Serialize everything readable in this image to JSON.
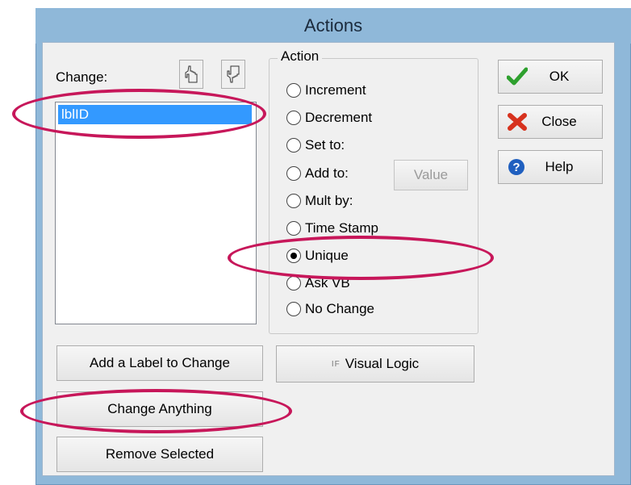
{
  "window": {
    "title": "Actions"
  },
  "change_panel": {
    "label": "Change:",
    "items": [
      "lblID"
    ],
    "selected_index": 0
  },
  "action_group": {
    "legend": "Action",
    "options": [
      {
        "label": "Increment",
        "checked": false
      },
      {
        "label": "Decrement",
        "checked": false
      },
      {
        "label": "Set to:",
        "checked": false
      },
      {
        "label": "Add to:",
        "checked": false
      },
      {
        "label": "Mult by:",
        "checked": false
      },
      {
        "label": "Time Stamp",
        "checked": false
      },
      {
        "label": "Unique",
        "checked": true
      },
      {
        "label": "Ask VB",
        "checked": false
      },
      {
        "label": "No Change",
        "checked": false
      }
    ],
    "value_button": "Value"
  },
  "buttons": {
    "add_label": "Add a Label to Change",
    "change_anything": "Change Anything",
    "remove_selected": "Remove Selected",
    "visual_logic": "Visual Logic",
    "visual_logic_icon_text": "IF",
    "ok": "OK",
    "close": "Close",
    "help": "Help"
  },
  "colors": {
    "title_bar": "#8fb8d9",
    "highlight_ellipse": "#c7175a",
    "selection": "#3399ff"
  }
}
